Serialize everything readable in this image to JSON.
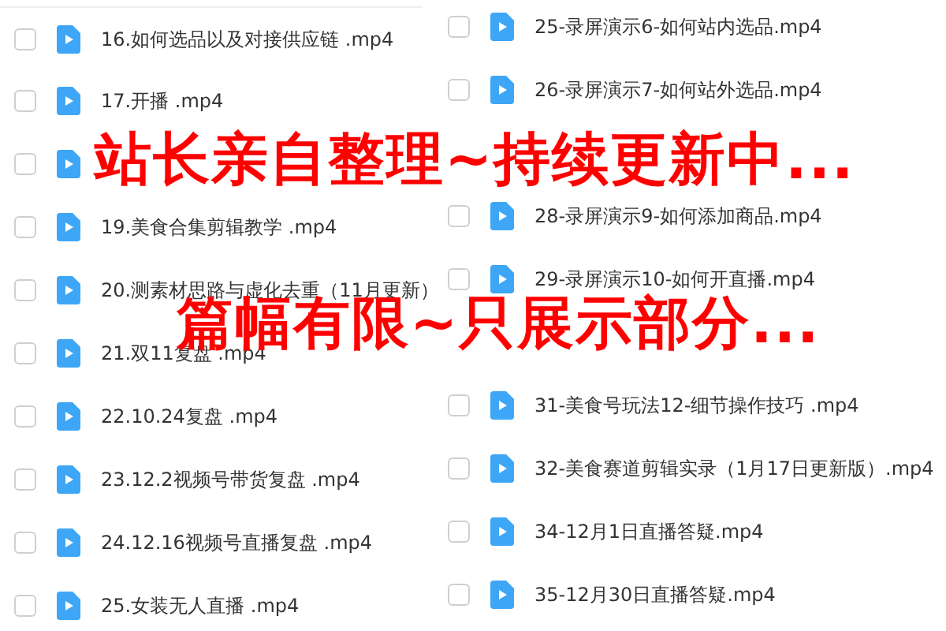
{
  "columns": [
    {
      "files": [
        {
          "name": "16.如何选品以及对接供应链 .mp4",
          "checked": false
        },
        {
          "name": "17.开播 .mp4",
          "checked": false
        },
        {
          "kind": "name_covered",
          "checked": false
        },
        {
          "name": "19.美食合集剪辑教学 .mp4",
          "checked": false
        },
        {
          "name": "20.测素材思路与虚化去重（11月更新）",
          "checked": false
        },
        {
          "name": "21.双11复盘 .mp4",
          "checked": false
        },
        {
          "name": "22.10.24复盘 .mp4",
          "checked": false
        },
        {
          "name": "23.12.2视频号带货复盘 .mp4",
          "checked": false
        },
        {
          "name": "24.12.16视频号直播复盘 .mp4",
          "checked": false
        },
        {
          "name": "25.女装无人直播 .mp4",
          "checked": false
        }
      ]
    },
    {
      "files": [
        {
          "name": "25-录屏演示6-如何站内选品.mp4",
          "checked": false
        },
        {
          "name": "26-录屏演示7-如何站外选品.mp4",
          "checked": false
        },
        {
          "kind": "covered"
        },
        {
          "name": "28-录屏演示9-如何添加商品.mp4",
          "checked": false
        },
        {
          "name": "29-录屏演示10-如何开直播.mp4",
          "checked": false
        },
        {
          "kind": "covered"
        },
        {
          "name": "31-美食号玩法12-细节操作技巧 .mp4",
          "checked": false
        },
        {
          "name": "32-美食赛道剪辑实录（1月17日更新版）.mp4",
          "checked": false
        },
        {
          "name": "34-12月1日直播答疑.mp4",
          "checked": false
        },
        {
          "name": "35-12月30日直播答疑.mp4",
          "checked": false
        }
      ]
    }
  ],
  "overlay_texts": [
    "站长亲自整理~持续更新中...",
    "篇幅有限~只展示部分..."
  ]
}
